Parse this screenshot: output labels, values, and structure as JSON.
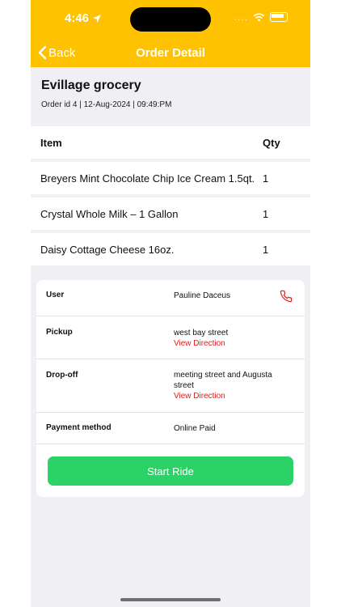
{
  "status_bar": {
    "time": "4:46",
    "dots": "...."
  },
  "nav": {
    "back_label": "Back",
    "title": "Order Detail"
  },
  "store": {
    "name": "Evillage grocery",
    "meta": "Order id 4 | 12-Aug-2024 | 09:49:PM"
  },
  "table": {
    "headers": {
      "item": "Item",
      "qty": "Qty"
    },
    "rows": [
      {
        "item": "Breyers Mint Chocolate Chip Ice Cream 1.5qt.",
        "qty": "1"
      },
      {
        "item": "Crystal Whole Milk – 1 Gallon",
        "qty": "1"
      },
      {
        "item": "Daisy Cottage Cheese 16oz.",
        "qty": "1"
      }
    ]
  },
  "details": {
    "user_label": "User",
    "user_value": "Pauline Daceus",
    "pickup_label": "Pickup",
    "pickup_value": "west bay street",
    "pickup_link": "View Direction",
    "dropoff_label": "Drop-off",
    "dropoff_value": "meeting street and Augusta street",
    "dropoff_link": "View Direction",
    "payment_label": "Payment method",
    "payment_value": "Online Paid"
  },
  "actions": {
    "start_ride": "Start Ride"
  },
  "colors": {
    "header": "#ffc200",
    "link": "#e11b1b",
    "button": "#2bd266",
    "background": "#efeff4"
  }
}
